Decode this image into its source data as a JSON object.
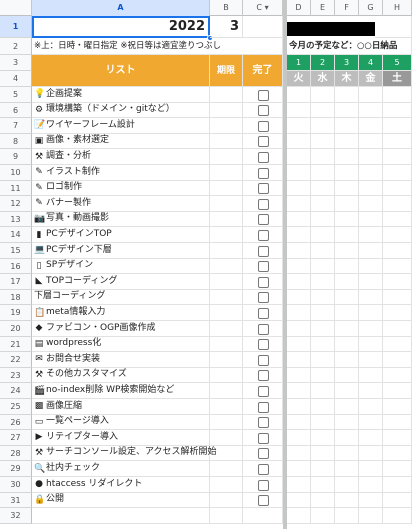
{
  "columns": [
    "A",
    "B",
    "C",
    "D",
    "E",
    "F",
    "G",
    "H"
  ],
  "column_c_dropdown": "▾",
  "rows": [
    "1",
    "2",
    "3",
    "4",
    "5",
    "6",
    "7",
    "8",
    "9",
    "10",
    "11",
    "12",
    "13",
    "14",
    "15",
    "16",
    "17",
    "18",
    "19",
    "20",
    "21",
    "22",
    "23",
    "24",
    "25",
    "26",
    "27",
    "28",
    "29",
    "30",
    "31",
    "32"
  ],
  "year": "2022",
  "month": "3",
  "note": "※上：日時・曜日指定 ※祝日等は適宜塗りつぶし",
  "right_title": "今月の予定など：○○日納品",
  "header": {
    "list": "リスト",
    "deadline": "期限",
    "done": "完了"
  },
  "days": [
    {
      "num": "1",
      "dow": "火"
    },
    {
      "num": "2",
      "dow": "水"
    },
    {
      "num": "3",
      "dow": "木"
    },
    {
      "num": "4",
      "dow": "金"
    },
    {
      "num": "5",
      "dow": "土"
    }
  ],
  "tasks": [
    {
      "icon": "💡",
      "icon_name": "lightbulb-icon",
      "label": "企画提案"
    },
    {
      "icon": "⚙",
      "icon_name": "gear-icon",
      "label": "環境構築（ドメイン・gitなど）"
    },
    {
      "icon": "📝",
      "icon_name": "memo-icon",
      "label": "ワイヤーフレーム設計"
    },
    {
      "icon": "▣",
      "icon_name": "picture-icon",
      "label": "画像・素材選定"
    },
    {
      "icon": "⚒",
      "icon_name": "tools-icon",
      "label": "調査・分析"
    },
    {
      "icon": "✎",
      "icon_name": "pencil-icon",
      "label": "イラスト制作"
    },
    {
      "icon": "✎",
      "icon_name": "pencil-icon",
      "label": "ロゴ制作"
    },
    {
      "icon": "✎",
      "icon_name": "pencil-icon",
      "label": "バナー製作"
    },
    {
      "icon": "📷",
      "icon_name": "camera-icon",
      "label": "写真・動画撮影"
    },
    {
      "icon": "▮",
      "icon_name": "bookmark-icon",
      "label": "PCデザインTOP"
    },
    {
      "icon": "💻",
      "icon_name": "laptop-icon",
      "label": "PCデザイン下層"
    },
    {
      "icon": "▯",
      "icon_name": "smartphone-icon",
      "label": "SPデザイン"
    },
    {
      "icon": "◣",
      "icon_name": "triangle-ruler-icon",
      "label": "TOPコーディング"
    },
    {
      "icon": "",
      "icon_name": "",
      "label": "下層コーディング"
    },
    {
      "icon": "📋",
      "icon_name": "clipboard-icon",
      "label": "meta情報入力"
    },
    {
      "icon": "◆",
      "icon_name": "gem-icon",
      "label": "ファビコン・OGP画像作成"
    },
    {
      "icon": "▤",
      "icon_name": "wordpress-icon",
      "label": "wordpress化"
    },
    {
      "icon": "✉",
      "icon_name": "mailbox-icon",
      "label": "お問合せ実装"
    },
    {
      "icon": "⚒",
      "icon_name": "tools-icon",
      "label": "その他カスタマイズ"
    },
    {
      "icon": "🎬",
      "icon_name": "clapper-icon",
      "label": "no-index削除 WP検索開始など"
    },
    {
      "icon": "▩",
      "icon_name": "photo-icon",
      "label": "画像圧縮"
    },
    {
      "icon": "▭",
      "icon_name": "page-icon",
      "label": "一覧ページ導入"
    },
    {
      "icon": "▶",
      "icon_name": "arrow-icon",
      "label": "リテイプター導入"
    },
    {
      "icon": "⚒",
      "icon_name": "tools-icon",
      "label": "サーチコンソール設定、アクセス解析開始"
    },
    {
      "icon": "🔍",
      "icon_name": "magnifier-icon",
      "label": "社内チェック"
    },
    {
      "icon": "●",
      "icon_name": "globe-icon",
      "label": "htaccess リダイレクト"
    },
    {
      "icon": "🔒",
      "icon_name": "lock-icon",
      "label": "公開"
    }
  ],
  "colors": {
    "header_orange": "#f0a830",
    "day_green": "#1ea063",
    "selection_blue": "#1a73e8"
  }
}
